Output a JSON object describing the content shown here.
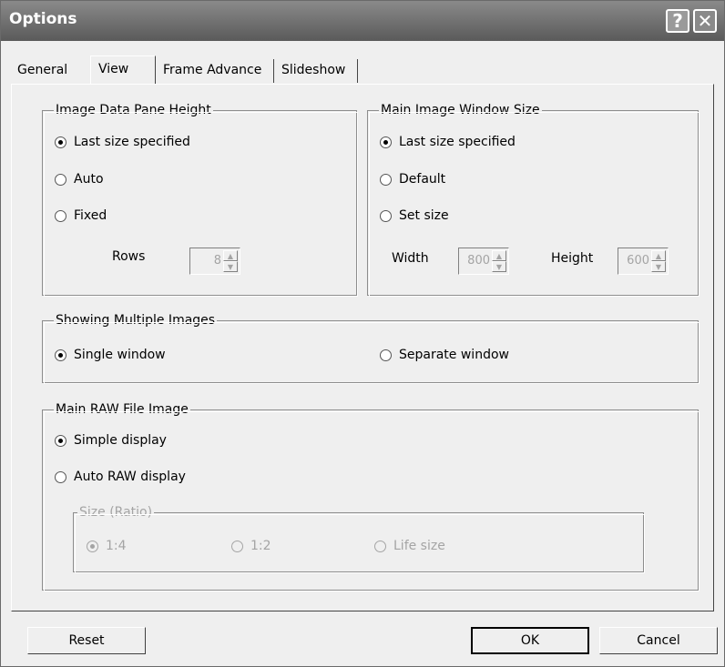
{
  "window": {
    "title": "Options",
    "help_glyph": "?",
    "close_glyph": "✕"
  },
  "tabs": [
    {
      "label": "General",
      "active": false
    },
    {
      "label": "View",
      "active": true
    },
    {
      "label": "Frame Advance",
      "active": false
    },
    {
      "label": "Slideshow",
      "active": false
    }
  ],
  "image_data_pane": {
    "title": "Image Data Pane Height",
    "options": [
      "Last size specified",
      "Auto",
      "Fixed"
    ],
    "selected": "Last size specified",
    "rows_label": "Rows",
    "rows_value": "8"
  },
  "main_window_size": {
    "title": "Main Image Window Size",
    "options": [
      "Last size specified",
      "Default",
      "Set size"
    ],
    "selected": "Last size specified",
    "width_label": "Width",
    "width_value": "800",
    "height_label": "Height",
    "height_value": "600"
  },
  "multiple_images": {
    "title": "Showing Multiple Images",
    "options": [
      "Single window",
      "Separate window"
    ],
    "selected": "Single window"
  },
  "raw_file": {
    "title": "Main RAW File Image",
    "options": [
      "Simple display",
      "Auto RAW display"
    ],
    "selected": "Simple display",
    "ratio": {
      "title": "Size (Ratio)",
      "options": [
        "1:4",
        "1:2",
        "Life size"
      ],
      "selected": "1:4",
      "disabled": true
    }
  },
  "buttons": {
    "reset": "Reset",
    "ok": "OK",
    "cancel": "Cancel"
  }
}
